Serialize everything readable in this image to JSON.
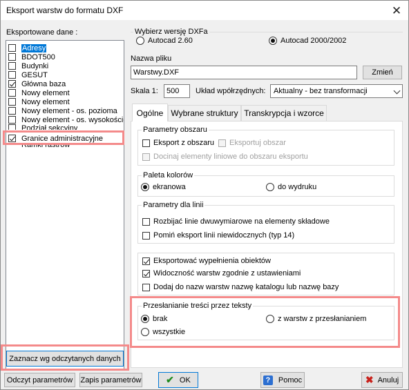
{
  "window": {
    "title": "Eksport warstw do formatu DXF"
  },
  "left": {
    "label": "Eksportowane dane :",
    "items": [
      {
        "label": "Adresy",
        "checked": false,
        "selected": true
      },
      {
        "label": "BDOT500",
        "checked": false
      },
      {
        "label": "Budynki",
        "checked": false
      },
      {
        "label": "GESUT",
        "checked": false
      },
      {
        "label": "Główna baza",
        "checked": true
      },
      {
        "label": "Nowy element",
        "checked": false
      },
      {
        "label": "Nowy element",
        "checked": false
      },
      {
        "label": "Nowy element - os. pozioma",
        "checked": false
      },
      {
        "label": "Nowy element - os. wysokościo",
        "checked": false
      },
      {
        "label": "Podział sekcyjny",
        "checked": false
      },
      {
        "label": "Granice administracyjne",
        "checked": true
      },
      {
        "label": "Ramki rastrów",
        "checked": false
      }
    ],
    "mark_button": "Zaznacz wg odczytanych danych"
  },
  "version": {
    "title": "Wybierz wersję DXFa",
    "option1": "Autocad 2.60",
    "option2": "Autocad 2000/2002"
  },
  "file": {
    "label": "Nazwa pliku",
    "value": "Warstwy.DXF",
    "change_button": "Zmień"
  },
  "scale": {
    "label": "Skala 1:",
    "value": "500"
  },
  "coords": {
    "label": "Układ wpółrzędnych:",
    "value": "Aktualny - bez transformacji"
  },
  "tabs": [
    "Ogólne",
    "Wybrane struktury",
    "Transkrypcja i wzorce"
  ],
  "area": {
    "title": "Parametry obszaru",
    "export_area": "Eksport z obszaru",
    "export_zone": "Eksportuj obszar",
    "attach_lines": "Docinaj elementy liniowe do obszaru eksportu"
  },
  "palette": {
    "title": "Paleta kolorów",
    "screen": "ekranowa",
    "print": "do wydruku"
  },
  "lines": {
    "title": "Parametry dla linii",
    "split": "Rozbijać linie dwuwymiarowe na elementy składowe",
    "skip": "Pomiń eksport linii niewidocznych (typ 14)"
  },
  "other": {
    "fill": "Eksportować wypełnienia obiektów",
    "visibility": "Widoczność warstw zgodnie z ustawieniami",
    "catalog": "Dodaj do nazw warstw nazwę katalogu lub nazwę bazy"
  },
  "overlap": {
    "title": "Przesłanianie treści przez teksty",
    "none": "brak",
    "from_layers": "z warstw z przesłanianiem",
    "all": "wszystkie"
  },
  "footer": {
    "read": "Odczyt parametrów",
    "save": "Zapis parametrów",
    "ok": "OK",
    "help": "Pomoc",
    "cancel": "Anuluj"
  }
}
